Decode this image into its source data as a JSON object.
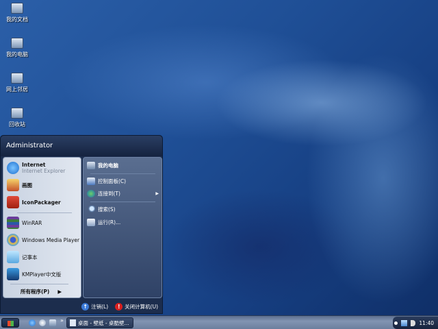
{
  "desktop_icons": [
    "我的文档",
    "我的电脑",
    "网上邻居",
    "回收站"
  ],
  "start_menu": {
    "user": "Administrator",
    "pinned": [
      {
        "label": "Internet",
        "sub": "Internet Explorer"
      },
      {
        "label": "画图"
      },
      {
        "label": "IconPackager"
      }
    ],
    "recent": [
      "WinRAR",
      "Windows Media Player",
      "记事本",
      "KMPlayer中文版"
    ],
    "all_programs": "所有程序(P)",
    "right": [
      "我的电脑",
      "控制面板(C)",
      "连接到(T)",
      "搜索(S)",
      "运行(R)..."
    ],
    "logoff": "注销(L)",
    "shutdown": "关闭计算机(U)"
  },
  "taskbar": {
    "chevron": "»",
    "task": "桌面 - 壁纸 - 桌酷壁...",
    "clock": "11:40"
  }
}
